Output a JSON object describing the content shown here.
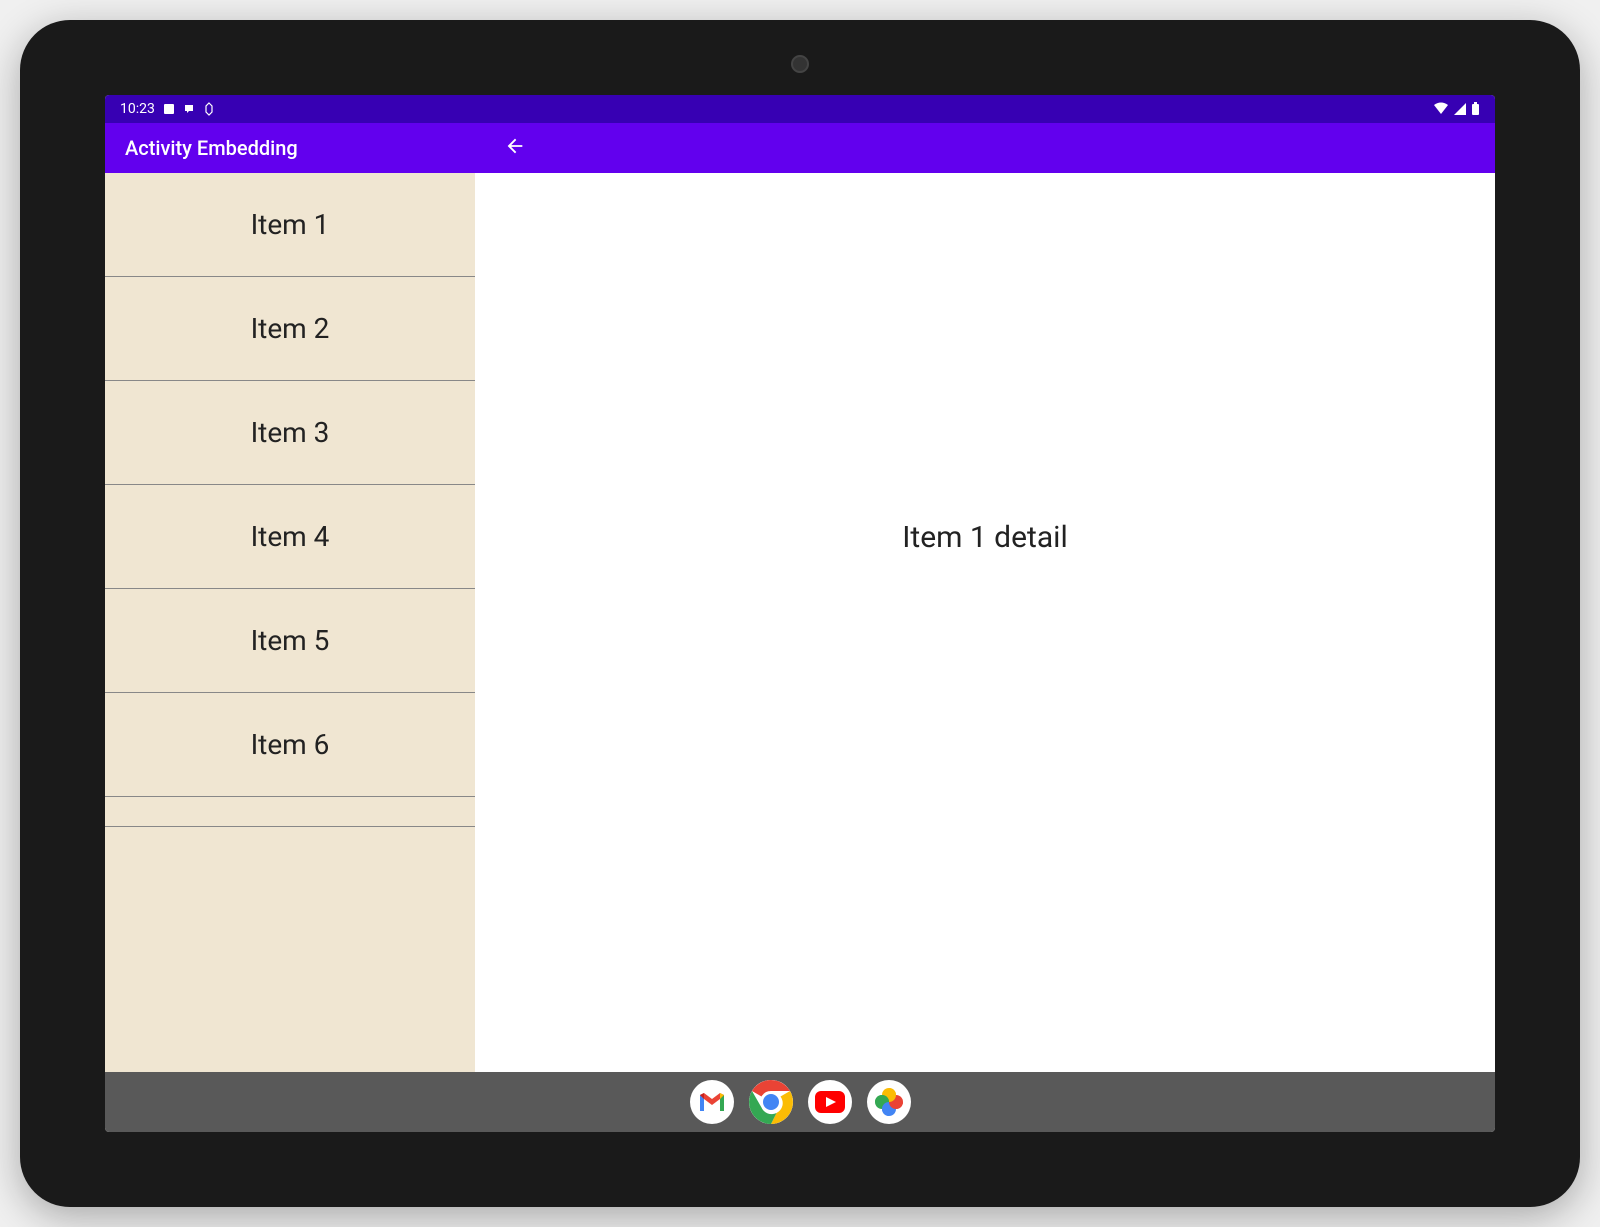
{
  "status_bar": {
    "time": "10:23",
    "icons_left": [
      "notification-icon",
      "app-icon",
      "debug-icon"
    ],
    "icons_right": [
      "wifi-icon",
      "signal-icon",
      "battery-icon"
    ]
  },
  "app_bar": {
    "title": "Activity Embedding"
  },
  "list": {
    "items": [
      {
        "label": "Item 1"
      },
      {
        "label": "Item 2"
      },
      {
        "label": "Item 3"
      },
      {
        "label": "Item 4"
      },
      {
        "label": "Item 5"
      },
      {
        "label": "Item 6"
      }
    ]
  },
  "detail": {
    "text": "Item 1 detail"
  },
  "nav_bar": {
    "apps": [
      "gmail",
      "chrome",
      "youtube",
      "photos"
    ]
  },
  "colors": {
    "status_bar": "#3700b3",
    "app_bar": "#6200ee",
    "list_bg": "#f0e6d2",
    "nav_bar": "#595959"
  }
}
